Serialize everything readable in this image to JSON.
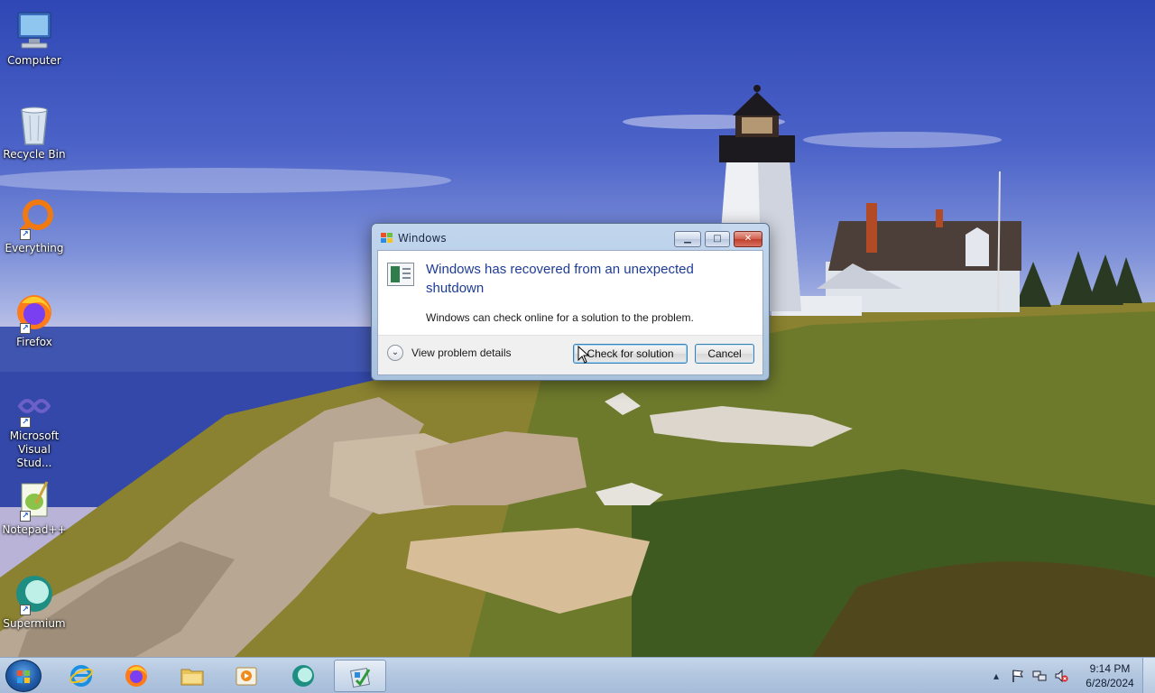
{
  "desktop": {
    "icons": [
      {
        "label": "Computer",
        "icon": "computer-icon"
      },
      {
        "label": "Recycle Bin",
        "icon": "recycle-bin-icon"
      },
      {
        "label": "Everything",
        "icon": "everything-search-icon"
      },
      {
        "label": "Firefox",
        "icon": "firefox-icon"
      },
      {
        "label": "Microsoft Visual Stud...",
        "icon": "visual-studio-icon"
      },
      {
        "label": "Notepad++",
        "icon": "notepadpp-icon"
      },
      {
        "label": "Supermium",
        "icon": "supermium-icon"
      }
    ]
  },
  "dialog": {
    "title": "Windows",
    "main_instruction": "Windows has recovered from an unexpected shutdown",
    "sub_instruction": "Windows can check online for a solution to the problem.",
    "details_label": "View problem details",
    "check_button": "Check for solution",
    "cancel_button": "Cancel",
    "caption_buttons": {
      "minimize": "minimize-icon",
      "maximize": "maximize-icon",
      "close": "close-icon"
    }
  },
  "taskbar": {
    "start": "windows-start-icon",
    "pinned": [
      {
        "name": "internet-explorer-icon"
      },
      {
        "name": "firefox-icon"
      },
      {
        "name": "file-explorer-icon"
      },
      {
        "name": "media-player-icon"
      },
      {
        "name": "supermium-icon"
      },
      {
        "name": "problem-reporting-icon",
        "active": true
      }
    ],
    "tray": {
      "time": "9:14 PM",
      "date": "6/28/2024",
      "icons": [
        "show-hidden-icons-arrow",
        "action-center-flag-icon",
        "network-icon",
        "volume-muted-icon"
      ]
    }
  }
}
